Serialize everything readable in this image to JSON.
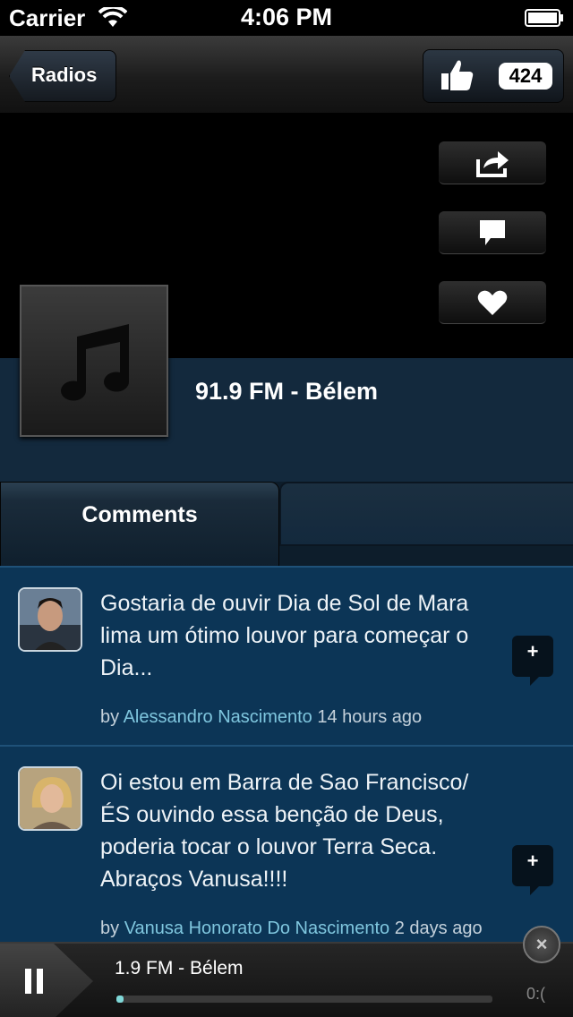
{
  "status_bar": {
    "carrier": "Carrier",
    "time": "4:06 PM"
  },
  "nav": {
    "back_label": "Radios",
    "like_count": "424"
  },
  "station": {
    "name": "91.9 FM - Bélem"
  },
  "tabs": {
    "active_label": "Comments"
  },
  "comments": [
    {
      "text": "Gostaria de ouvir Dia de Sol de Mara lima um ótimo louvor para começar o Dia...",
      "by": "by",
      "author": "Alessandro Nascimento",
      "time": "14 hours ago",
      "reply_label": "+"
    },
    {
      "text": "Oi estou em Barra de Sao Francisco/ÉS ouvindo essa benção de Deus, poderia tocar o louvor Terra Seca. Abraços Vanusa!!!!",
      "by": "by",
      "author": "Vanusa Honorato Do Nascimento",
      "time": "2 days ago",
      "reply_label": "+"
    }
  ],
  "player": {
    "now_playing": "1.9 FM - Bélem",
    "elapsed": "0:(",
    "progress_fraction": 0.02,
    "close_label": "×"
  },
  "colors": {
    "accent": "#7fc6de",
    "band": "#13293d",
    "comment_bg": "#0c3556"
  },
  "icons": [
    "wifi-icon",
    "battery-icon",
    "thumbs-up-icon",
    "share-icon",
    "comment-icon",
    "heart-icon",
    "music-note-icon",
    "pause-icon",
    "close-icon"
  ]
}
